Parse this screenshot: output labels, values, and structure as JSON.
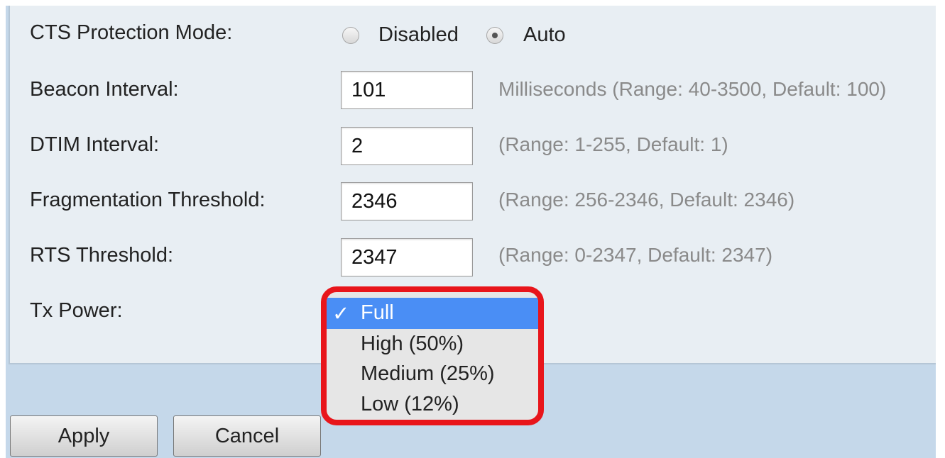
{
  "form": {
    "cts": {
      "label": "CTS Protection Mode:",
      "options": [
        {
          "label": "Disabled",
          "selected": false
        },
        {
          "label": "Auto",
          "selected": true
        }
      ]
    },
    "beacon": {
      "label": "Beacon Interval:",
      "value": "101",
      "hint": "Milliseconds (Range: 40-3500, Default: 100)"
    },
    "dtim": {
      "label": "DTIM Interval:",
      "value": "2",
      "hint": "(Range: 1-255, Default: 1)"
    },
    "frag": {
      "label": "Fragmentation Threshold:",
      "value": "2346",
      "hint": "(Range: 256-2346, Default: 2346)"
    },
    "rts": {
      "label": "RTS Threshold:",
      "value": "2347",
      "hint": "(Range: 0-2347, Default: 2347)"
    },
    "tx_power": {
      "label": "Tx Power:",
      "check_glyph": "✓",
      "options": [
        "Full",
        "High (50%)",
        "Medium (25%)",
        "Low (12%)"
      ],
      "selected": "Full"
    }
  },
  "buttons": {
    "apply": "Apply",
    "cancel": "Cancel"
  },
  "colors": {
    "highlight_ring": "#e8151b",
    "selected_option": "#4a8ef5",
    "panel_bg": "#e8eef3",
    "outer_bg": "#c5d8ea"
  }
}
